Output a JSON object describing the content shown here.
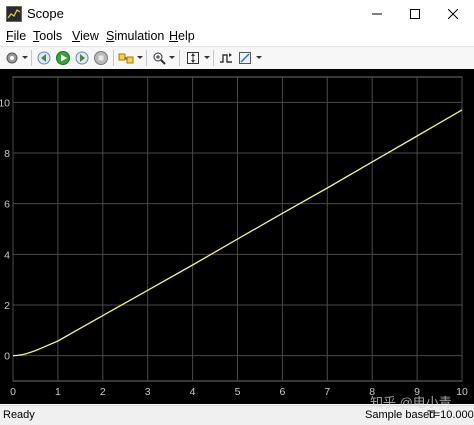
{
  "window": {
    "title": "Scope"
  },
  "menu": [
    {
      "key": "F",
      "rest": "ile"
    },
    {
      "key": "T",
      "rest": "ools"
    },
    {
      "key": "V",
      "rest": "iew"
    },
    {
      "key": "S",
      "rest": "imulation"
    },
    {
      "key": "H",
      "rest": "elp"
    }
  ],
  "toolbar": {
    "icons": [
      "settings-icon",
      "step-back-icon",
      "run-icon",
      "step-forward-icon",
      "stop-icon",
      "highlight-block-icon",
      "zoom-icon",
      "autoscale-icon",
      "triggers-icon",
      "cursor-measurements-icon"
    ]
  },
  "status": {
    "left": "Ready",
    "mid": "Sample based",
    "right": "T=10.000"
  },
  "watermark": "知乎 @电小青",
  "colors": {
    "plot_bg": "#000000",
    "grid": "#4a4a4a",
    "trace": "#f2f28c",
    "axis_text": "#c8c8c8"
  },
  "chart_data": {
    "type": "line",
    "title": "",
    "xlabel": "",
    "ylabel": "",
    "xlim": [
      0,
      10
    ],
    "ylim": [
      -1,
      11
    ],
    "xticks": [
      0,
      1,
      2,
      3,
      4,
      5,
      6,
      7,
      8,
      9,
      10
    ],
    "yticks": [
      0,
      2,
      4,
      6,
      8,
      10
    ],
    "grid": true,
    "series": [
      {
        "x": [
          0,
          0.1,
          0.2,
          0.3,
          0.4,
          0.5,
          0.7,
          1,
          2,
          3,
          4,
          5,
          6,
          7,
          8,
          9,
          10
        ],
        "y": [
          0,
          0.01,
          0.04,
          0.08,
          0.14,
          0.2,
          0.35,
          0.58,
          1.58,
          2.58,
          3.58,
          4.6,
          5.62,
          6.62,
          7.65,
          8.67,
          9.7
        ]
      }
    ]
  }
}
